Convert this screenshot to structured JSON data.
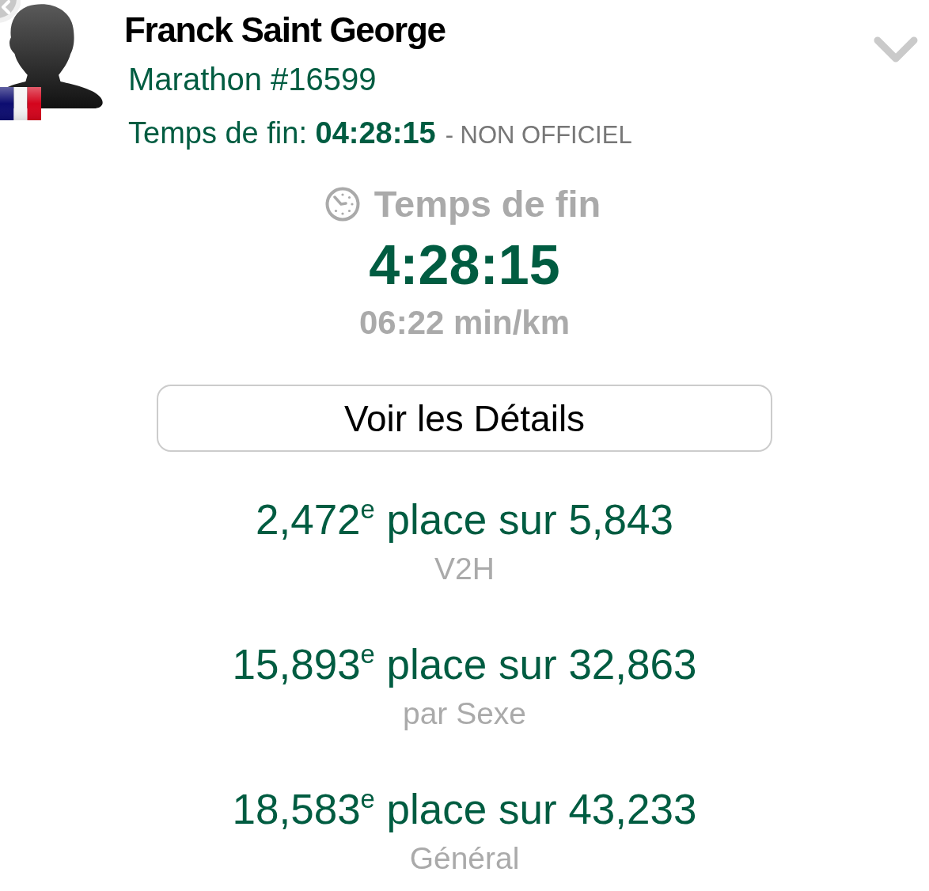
{
  "header": {
    "name": "Franck Saint George",
    "race": "Marathon #16599",
    "finish_line": "Temps de fin: **04:28:15**",
    "status": "- NON OFFICIEL"
  },
  "summary": {
    "title": "Temps de fin",
    "time": "4:28:15",
    "pace": "06:22 min/km"
  },
  "details_button": "Voir les Détails",
  "rankings": [
    {
      "place": "2,472$^{e}$ place sur 5,843",
      "category": "V2H"
    },
    {
      "place": "15,893$^{e}$ place sur 32,863",
      "category": "par Sexe"
    },
    {
      "place": "18,583$^{e}$ place sur 43,233",
      "category": "Général"
    }
  ]
}
